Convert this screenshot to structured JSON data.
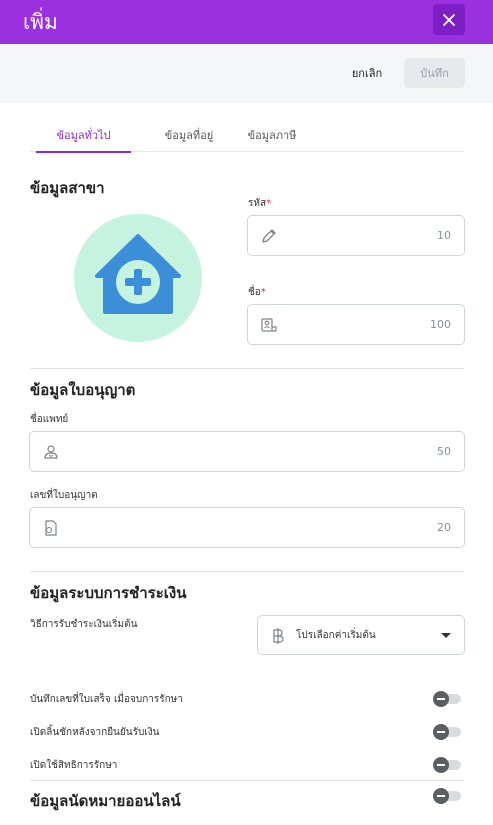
{
  "header": {
    "title": "เพิ่ม",
    "close_icon": "close-icon"
  },
  "toolbar": {
    "cancel_label": "ยกเลิก",
    "save_label": "บันทึก"
  },
  "tabs": [
    {
      "label": "ข้อมูลทั่วไป",
      "active": true
    },
    {
      "label": "ข้อมูลที่อยู่",
      "active": false
    },
    {
      "label": "ข้อมูลภาษี",
      "active": false
    }
  ],
  "branch": {
    "title": "ข้อมูลสาขา",
    "avatar_icon": "clinic-house-plus-icon",
    "code": {
      "label": "รหัส",
      "required_mark": "*",
      "icon": "pencil-icon",
      "counter": "10"
    },
    "name": {
      "label": "ชื่อ",
      "required_mark": "*",
      "icon": "name-card-icon",
      "counter": "100"
    }
  },
  "license": {
    "title": "ข้อมูลใบอนุญาต",
    "doctor": {
      "label": "ชื่อแพทย์",
      "icon": "doctor-icon",
      "counter": "50"
    },
    "license_no": {
      "label": "เลขที่ใบอนุญาต",
      "icon": "license-document-icon",
      "counter": "20"
    }
  },
  "payment": {
    "title": "ข้อมูลระบบการชำระเงิน",
    "method_label": "วิธีการรับชำระเงินเริ่มต้น",
    "method_icon": "baht-icon",
    "method_value": "โปรเลือกค่าเริ่มต้น",
    "toggles": [
      {
        "label": "บันทึกเลขที่ใบเสร็จ เมื่อจบการรักษา",
        "on": false
      },
      {
        "label": "เปิดลิ้นชักหลังจากยืนยันรับเงิน",
        "on": false
      },
      {
        "label": "เปิดใช้สิทธิการรักษา",
        "on": false
      }
    ]
  },
  "online": {
    "title": "ข้อมูลนัดหมายออนไลน์",
    "toggle_on": false
  },
  "colors": {
    "header": "#9b30e0",
    "accent": "#8e2bd8",
    "avatar_bg": "#c5f3e0",
    "avatar_icon": "#3a8fd8",
    "required": "#e0304a"
  }
}
